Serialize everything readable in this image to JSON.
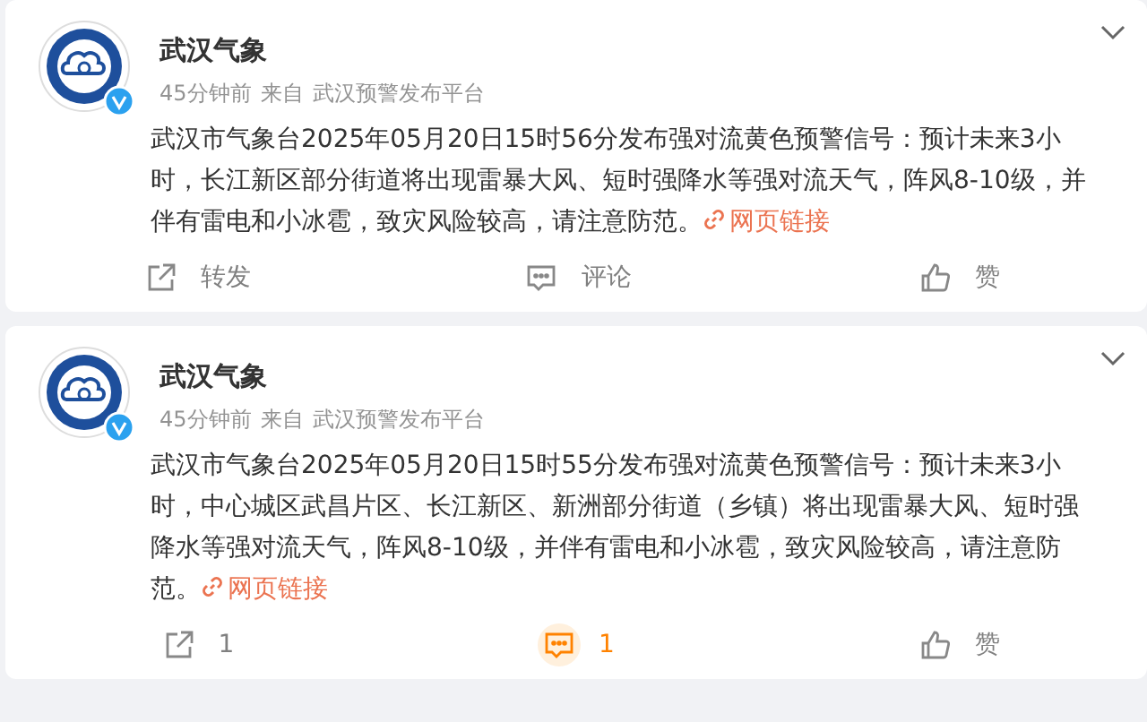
{
  "posts": [
    {
      "author": "武汉气象",
      "verified": true,
      "time": "45分钟前",
      "source_prefix": "来自",
      "source": "武汉预警发布平台",
      "text": "武汉市气象台2025年05月20日15时56分发布强对流黄色预警信号：预计未来3小时，长江新区部分街道将出现雷暴大风、短时强降水等强对流天气，阵风8-10级，并伴有雷电和小冰雹，致灾风险较高，请注意防范。",
      "link": "网页链接",
      "actions": [
        {
          "kind": "repost",
          "label": "转发",
          "active": false
        },
        {
          "kind": "comment",
          "label": "评论",
          "active": false
        },
        {
          "kind": "like",
          "label": "赞",
          "active": false
        }
      ]
    },
    {
      "author": "武汉气象",
      "verified": true,
      "time": "45分钟前",
      "source_prefix": "来自",
      "source": "武汉预警发布平台",
      "text": "武汉市气象台2025年05月20日15时55分发布强对流黄色预警信号：预计未来3小时，中心城区武昌片区、长江新区、新洲部分街道（乡镇）将出现雷暴大风、短时强降水等强对流天气，阵风8-10级，并伴有雷电和小冰雹，致灾风险较高，请注意防范。",
      "link": "网页链接",
      "actions": [
        {
          "kind": "repost",
          "label": "1",
          "active": false
        },
        {
          "kind": "comment",
          "label": "1",
          "active": true
        },
        {
          "kind": "like",
          "label": "赞",
          "active": false
        }
      ]
    }
  ]
}
